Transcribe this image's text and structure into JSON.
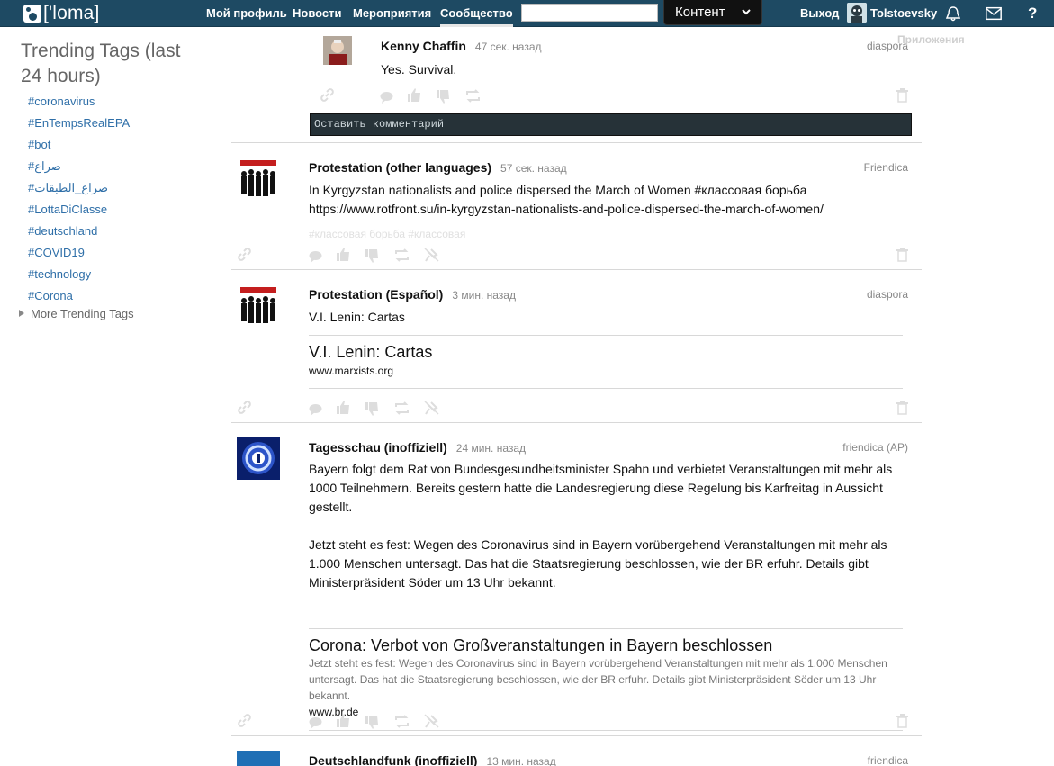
{
  "nav": {
    "logo_text": "['loma]",
    "links": [
      "Мой профиль",
      "Новости",
      "Мероприятия",
      "Сообщество"
    ],
    "search_value": "",
    "search_scope": "Контент",
    "logout": "Выход",
    "user": "Tolstoevsky",
    "help": "?",
    "apps_tooltip": "Приложения"
  },
  "sidebar": {
    "title": "Trending Tags (last 24 hours)",
    "tags": [
      "#coronavirus",
      "#EnTempsRealEPA",
      "#bot",
      "#صراع",
      "#صراع_الطبقات",
      "#LottaDiClasse",
      "#deutschland",
      "#COVID19",
      "#technology",
      "#Corona"
    ],
    "more": "More Trending Tags"
  },
  "comment": {
    "author": "Kenny Chaffin",
    "ago": "47 сек. назад",
    "network": "diaspora",
    "text": "Yes. Survival.",
    "placeholder": "Оставить комментарий"
  },
  "posts": [
    {
      "author": "Protestation (other languages)",
      "ago": "57 сек. назад",
      "network": "Friendica",
      "text": "In Kyrgyzstan nationalists and police dispersed the March of Women #классовая борьба https://www.rotfront.su/in-kyrgyzstan-nationalists-and-police-dispersed-the-march-of-women/",
      "tags": "#классовая борьба #классовая"
    },
    {
      "author": "Protestation (Español)",
      "ago": "3 мин. назад",
      "network": "diaspora",
      "text": "V.I. Lenin: Cartas",
      "embed_title": "V.I. Lenin: Cartas",
      "embed_url": "www.marxists.org"
    },
    {
      "author": "Tagesschau (inoffiziell)",
      "ago": "24 мин. назад",
      "network": "friendica (AP)",
      "text1": "Bayern folgt dem Rat von Bundesgesundheitsminister Spahn und verbietet Veranstaltungen mit mehr als 1000 Teilnehmern. Bereits gestern hatte die Landesregierung diese Regelung bis Karfreitag in Aussicht gestellt.",
      "text2": "Jetzt steht es fest: Wegen des Coronavirus sind in Bayern vorübergehend Veranstaltungen mit mehr als 1.000 Menschen untersagt. Das hat die Staatsregierung beschlossen, wie der BR erfuhr. Details gibt Ministerpräsident Söder um 13 Uhr bekannt.",
      "embed_title": "Corona: Verbot von Großveranstaltungen in Bayern beschlossen",
      "embed_desc": "Jetzt steht es fest: Wegen des Coronavirus sind in Bayern vorübergehend Veranstaltungen mit mehr als 1.000 Menschen untersagt. Das hat die Staatsregierung beschlossen, wie der BR erfuhr. Details gibt Ministerpräsident Söder um 13 Uhr bekannt.",
      "embed_url": "www.br.de"
    },
    {
      "author": "Deutschlandfunk (inoffiziell)",
      "ago": "13 мин. назад",
      "network": "friendica"
    }
  ],
  "colors": {
    "navbar": "#1e4a63",
    "link": "#2f6fa8",
    "icon": "#dddddd"
  }
}
